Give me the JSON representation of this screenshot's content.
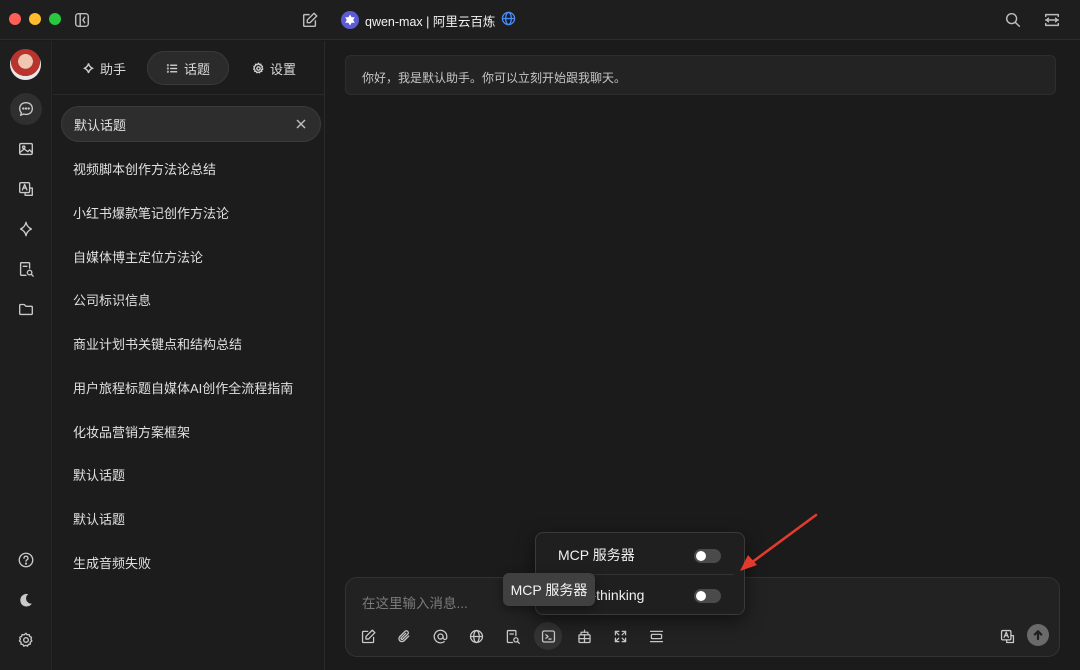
{
  "titlebar": {
    "model_name": "qwen-max | 阿里云百炼"
  },
  "sidebar": {
    "tabs": [
      {
        "label": "助手",
        "icon": "sparkle-icon"
      },
      {
        "label": "话题",
        "icon": "list-icon"
      },
      {
        "label": "设置",
        "icon": "gear-icon"
      }
    ],
    "active_tab": "话题",
    "topics": [
      "默认话题",
      "视频脚本创作方法论总结",
      "小红书爆款笔记创作方法论",
      "自媒体博主定位方法论",
      "公司标识信息",
      "商业计划书关键点和结构总结",
      "用户旅程标题自媒体AI创作全流程指南",
      "化妆品营销方案框架",
      "默认话题",
      "默认话题",
      "生成音频失败"
    ]
  },
  "chat": {
    "greeting": "你好，我是默认助手。你可以立刻开始跟我聊天。"
  },
  "composer": {
    "placeholder": "在这里输入消息..."
  },
  "mcp_popup": {
    "items": [
      {
        "label": "MCP 服务器",
        "enabled": false
      },
      {
        "label": "ential-thinking",
        "enabled": false
      }
    ]
  },
  "tooltip": {
    "text": "MCP 服务器"
  },
  "colors": {
    "annotation_arrow": "#e23b2e",
    "window_bg": "#1b1b1b",
    "model_logo": "#5b5bd6"
  }
}
